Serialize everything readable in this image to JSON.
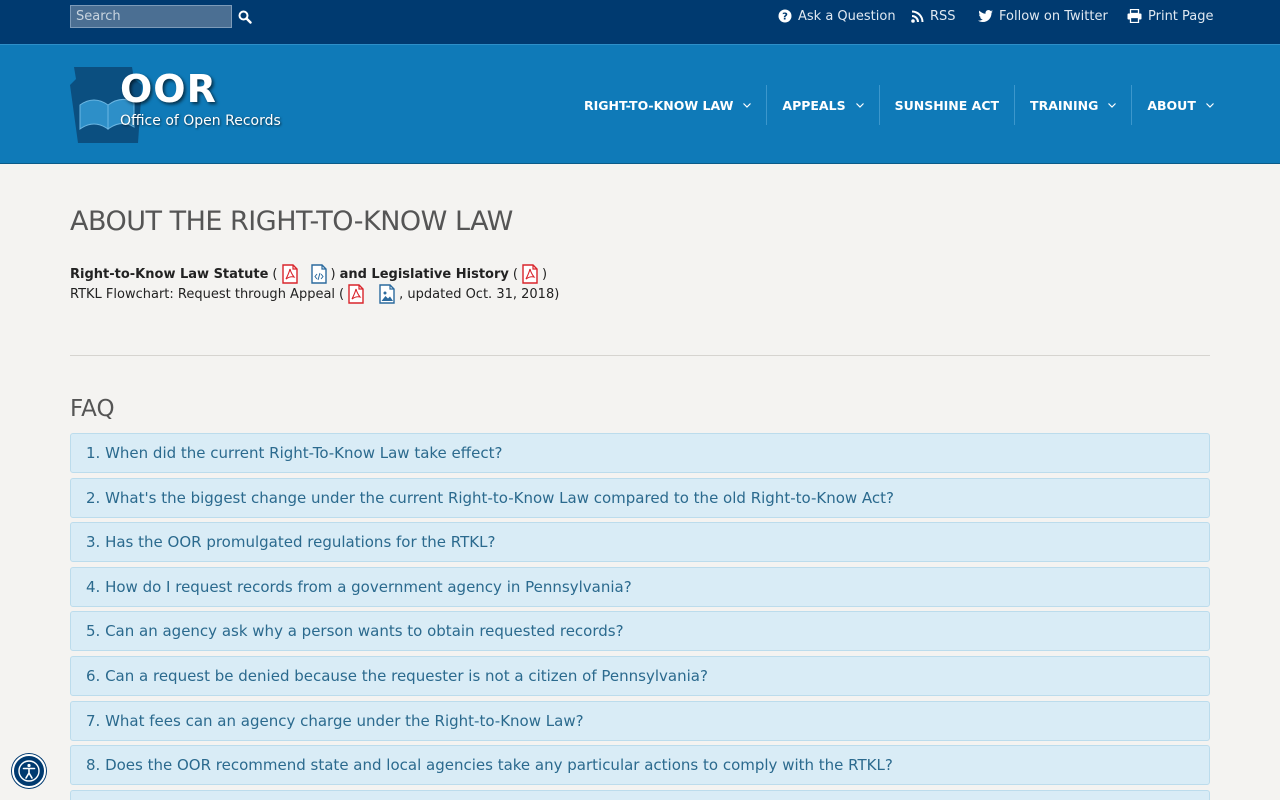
{
  "topbar": {
    "search_placeholder": "Search",
    "links": {
      "ask": "Ask a Question",
      "rss": "RSS",
      "twitter": "Follow on Twitter",
      "print": "Print Page"
    }
  },
  "header": {
    "logo_title": "OOR",
    "logo_subtitle": "Office of Open Records",
    "nav": [
      {
        "label": "RIGHT-TO-KNOW LAW",
        "has_dropdown": true
      },
      {
        "label": "APPEALS",
        "has_dropdown": true
      },
      {
        "label": "SUNSHINE ACT",
        "has_dropdown": false
      },
      {
        "label": "TRAINING",
        "has_dropdown": true
      },
      {
        "label": "ABOUT",
        "has_dropdown": true
      }
    ]
  },
  "main": {
    "title": "ABOUT THE RIGHT-TO-KNOW LAW",
    "docs": {
      "statute_label": "Right-to-Know Law Statute",
      "history_label": "and Legislative History",
      "flowchart_label": "RTKL Flowchart: Request through Appeal",
      "flowchart_updated": ", updated Oct. 31, 2018)",
      "paren_open": "(",
      "paren_close": ")"
    },
    "faq_heading": "FAQ",
    "faq": [
      "1. When did the current Right-To-Know Law take effect?",
      "2. What's the biggest change under the current Right-to-Know Law compared to the old Right-to-Know Act?",
      "3. Has the OOR promulgated regulations for the RTKL?",
      "4. How do I request records from a government agency in Pennsylvania?",
      "5. Can an agency ask why a person wants to obtain requested records?",
      "6. Can a request be denied because the requester is not a citizen of Pennsylvania?",
      "7. What fees can an agency charge under the Right-to-Know Law?",
      "8. Does the OOR recommend state and local agencies take any particular actions to comply with the RTKL?",
      ""
    ]
  },
  "colors": {
    "topbar": "#003a70",
    "header": "#0f7ab8",
    "faq_bg": "#d9ecf6",
    "faq_text": "#2b6a8e",
    "pdf_red": "#d9242b"
  }
}
